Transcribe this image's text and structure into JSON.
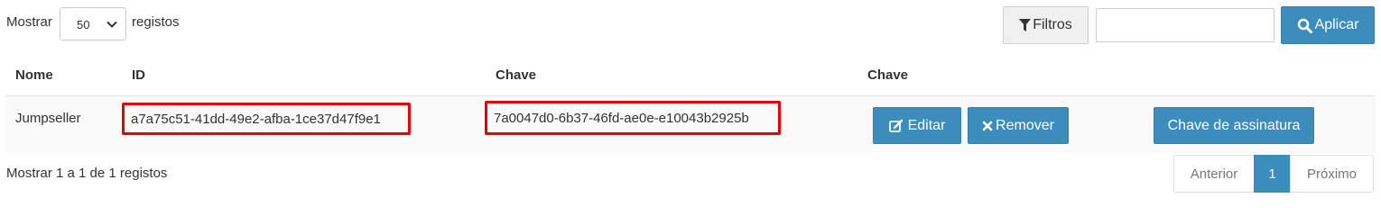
{
  "length_menu": {
    "prefix": "Mostrar",
    "selected": "50",
    "suffix": "registos"
  },
  "toolbar": {
    "filters_label": "Filtros",
    "search_value": "",
    "apply_label": "Aplicar"
  },
  "table": {
    "columns": [
      "Nome",
      "ID",
      "Chave",
      "Chave"
    ],
    "rows": [
      {
        "name": "Jumpseller",
        "id": "a7a75c51-41dd-49e2-afba-1ce37d47f9e1",
        "key": "7a0047d0-6b37-46fd-ae0e-e10043b2925b",
        "edit_label": "Editar",
        "remove_label": "Remover",
        "signature_label": "Chave de assinatura"
      }
    ]
  },
  "footer": {
    "info": "Mostrar 1 a 1 de 1 registos"
  },
  "pagination": {
    "previous": "Anterior",
    "current": "1",
    "next": "Próximo"
  },
  "colors": {
    "primary": "#3c8dbc",
    "highlight_border": "#e60000",
    "row_background": "#f9f9f9"
  }
}
